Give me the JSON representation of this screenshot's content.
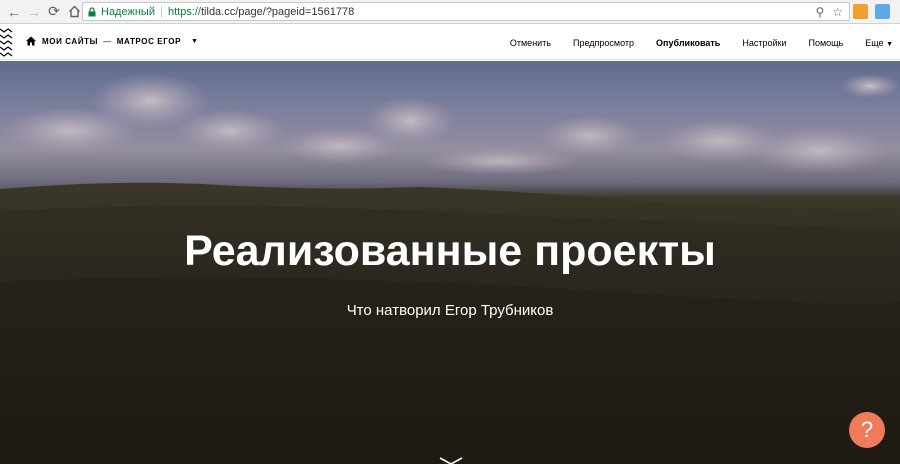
{
  "browser": {
    "secure_label": "Надежный",
    "url_scheme": "https://",
    "url_rest": "tilda.cc/page/?pageid=1561778"
  },
  "tilda_bar": {
    "breadcrumb": {
      "sites": "МОИ САЙТЫ",
      "separator": "—",
      "project": "МАТРОС ЕГОР"
    },
    "menu": {
      "cancel": "Отменить",
      "preview": "Предпросмотр",
      "publish": "Опубликовать",
      "settings": "Настройки",
      "help": "Помощь",
      "more": "Еще"
    }
  },
  "hero": {
    "title": "Реализованные проекты",
    "subtitle": "Что натворил Егор Трубников"
  },
  "help_button": {
    "label": "?"
  }
}
